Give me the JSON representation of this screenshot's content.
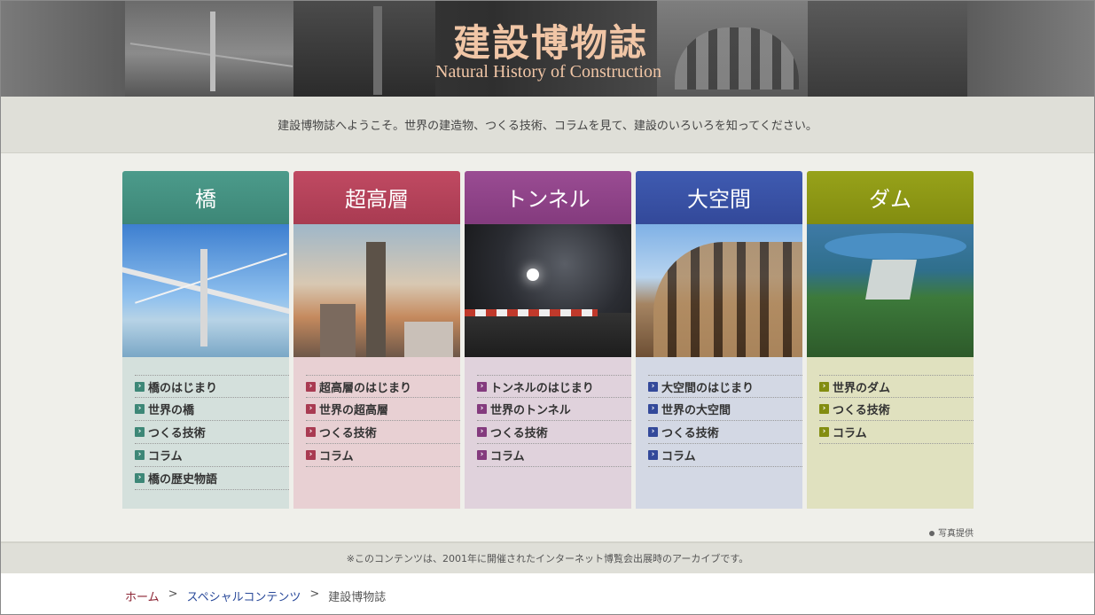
{
  "header": {
    "title": "建設博物誌",
    "subtitle": "Natural History of Construction"
  },
  "welcome": "建設博物誌へようこそ。世界の建造物、つくる技術、コラムを見て、建設のいろいろを知ってください。",
  "categories": [
    {
      "title": "橋",
      "color": "#3d8777",
      "links": [
        "橋のはじまり",
        "世界の橋",
        "つくる技術",
        "コラム",
        "橋の歴史物語"
      ]
    },
    {
      "title": "超高層",
      "color": "#a93b52",
      "links": [
        "超高層のはじまり",
        "世界の超高層",
        "つくる技術",
        "コラム"
      ]
    },
    {
      "title": "トンネル",
      "color": "#843b7e",
      "links": [
        "トンネルのはじまり",
        "世界のトンネル",
        "つくる技術",
        "コラム"
      ]
    },
    {
      "title": "大空間",
      "color": "#33499a",
      "links": [
        "大空間のはじまり",
        "世界の大空間",
        "つくる技術",
        "コラム"
      ]
    },
    {
      "title": "ダム",
      "color": "#838d10",
      "links": [
        "世界のダム",
        "つくる技術",
        "コラム"
      ]
    }
  ],
  "photo_credit": "写真提供",
  "archive_note": "※このコンテンツは、2001年に開催されたインターネット博覧会出展時のアーカイブです。",
  "breadcrumb": {
    "home": "ホーム",
    "separator": ">",
    "special": "スペシャルコンテンツ",
    "current": "建設博物誌"
  }
}
